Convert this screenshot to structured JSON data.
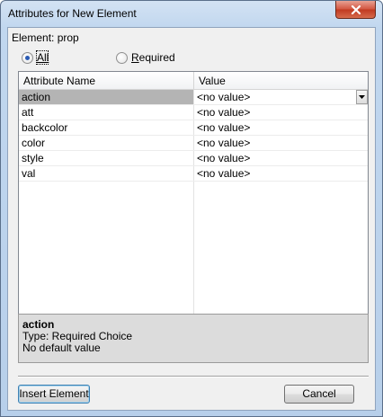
{
  "window": {
    "title": "Attributes for New Element"
  },
  "element_label": "Element: prop",
  "filter": {
    "all_label": "All",
    "required_label": "Required",
    "selected": "All"
  },
  "table": {
    "columns": [
      "Attribute Name",
      "Value"
    ],
    "rows": [
      {
        "name": "action",
        "value": "<no value>"
      },
      {
        "name": "att",
        "value": "<no value>"
      },
      {
        "name": "backcolor",
        "value": "<no value>"
      },
      {
        "name": "color",
        "value": "<no value>"
      },
      {
        "name": "style",
        "value": "<no value>"
      },
      {
        "name": "val",
        "value": "<no value>"
      }
    ],
    "selected_row": "action"
  },
  "description": {
    "title": "action",
    "type_line": "Type: Required Choice",
    "default_line": "No default value"
  },
  "buttons": {
    "insert_label": "Insert Element",
    "cancel_label": "Cancel"
  },
  "icons": {
    "close": "close-icon",
    "dropdown": "chevron-down-icon"
  },
  "colors": {
    "selection": "#b4b4b4",
    "close_button": "#c03920"
  }
}
